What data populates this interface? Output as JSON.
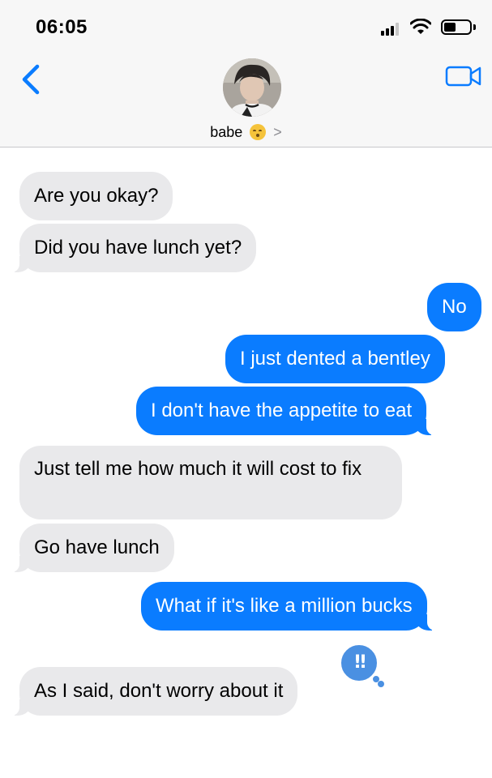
{
  "status_bar": {
    "time": "06:05"
  },
  "header": {
    "contact_name": "babe",
    "chevron": ">"
  },
  "messages": [
    {
      "direction": "incoming",
      "text": "Are you okay?"
    },
    {
      "direction": "incoming",
      "text": "Did you have lunch yet?"
    },
    {
      "direction": "outgoing",
      "text": "No"
    },
    {
      "direction": "outgoing",
      "text": "I just dented a bentley"
    },
    {
      "direction": "outgoing",
      "text": "I don't have the appetite to eat"
    },
    {
      "direction": "incoming",
      "text": "Just tell me how much it will cost to fix"
    },
    {
      "direction": "incoming",
      "text": "Go have lunch"
    },
    {
      "direction": "outgoing",
      "text": "What if it's like a million bucks"
    },
    {
      "direction": "incoming",
      "text": "As I said, don't worry about it",
      "tapback": "!!"
    }
  ],
  "colors": {
    "outgoing_bubble": "#0a7cff",
    "incoming_bubble": "#e9e9eb",
    "accent": "#0a7cff",
    "tapback": "#4a90e2"
  },
  "icons": {
    "back": "chevron-left-icon",
    "video": "video-camera-icon",
    "signal": "cellular-signal-icon",
    "wifi": "wifi-icon",
    "battery": "battery-icon",
    "emoji": "kissing-face-emoji"
  }
}
